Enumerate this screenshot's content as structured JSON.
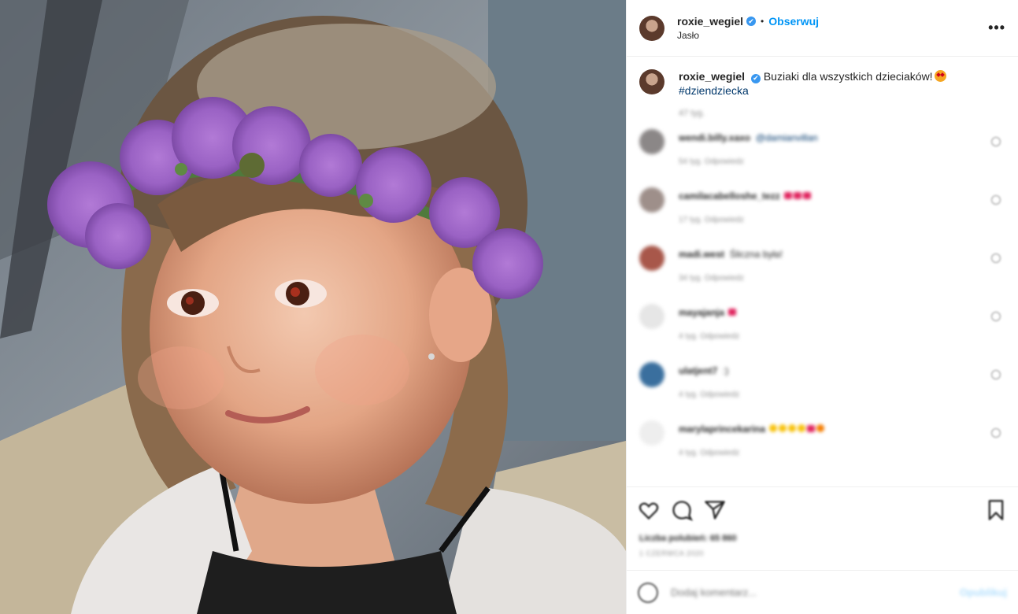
{
  "post": {
    "username": "roxie_wegiel",
    "verified_mark": "✔",
    "separator": "•",
    "follow_label": "Obserwuj",
    "location": "Jasło",
    "more_label": "•••"
  },
  "caption": {
    "username": "roxie_wegiel",
    "text": "Buziaki dla wszystkich dzieciaków!",
    "emoji": "star-struck-emoji",
    "hashtag": "#dziendziecka",
    "time": "47 tyg."
  },
  "comments": [
    {
      "user": "wendi.billy.xaxo",
      "text": "@damianvillan",
      "meta": "54 tyg.   Odpowiedz",
      "avatar_color": "#8b8787",
      "emoji": ""
    },
    {
      "user": "camilacabelloshe_tezz",
      "text": "",
      "meta": "17 tyg.   Odpowiedz",
      "avatar_color": "#9e8f8a",
      "emoji": "hearts"
    },
    {
      "user": "madi.west",
      "text": "Śliczna była!",
      "meta": "34 tyg.   Odpowiedz",
      "avatar_color": "#a8574a",
      "emoji": ""
    },
    {
      "user": "mayajanja",
      "text": "",
      "meta": "4 tyg.   Odpowiedz",
      "avatar_color": "#e6e6e6",
      "emoji": "heart"
    },
    {
      "user": "ulatjent7",
      "text": ":)",
      "meta": "4 tyg.   Odpowiedz",
      "avatar_color": "#3a6f9e",
      "emoji": ""
    },
    {
      "user": "marylaprincekarina",
      "text": "",
      "meta": "4 tyg.   Odpowiedz",
      "avatar_color": "#eeeeee",
      "emoji": "faces"
    }
  ],
  "likes": {
    "count_text": "Liczba polubień: 65 860",
    "date": "1 CZERWCA 2020"
  },
  "add_comment": {
    "placeholder": "Dodaj komentarz...",
    "post_label": "Opublikuj"
  },
  "colors": {
    "accent": "#0095f6",
    "verified": "#3897f0",
    "hashtag": "#00376b"
  },
  "icons": [
    "heart-icon",
    "comment-icon",
    "share-icon",
    "save-icon",
    "emoji-icon",
    "more-icon"
  ]
}
